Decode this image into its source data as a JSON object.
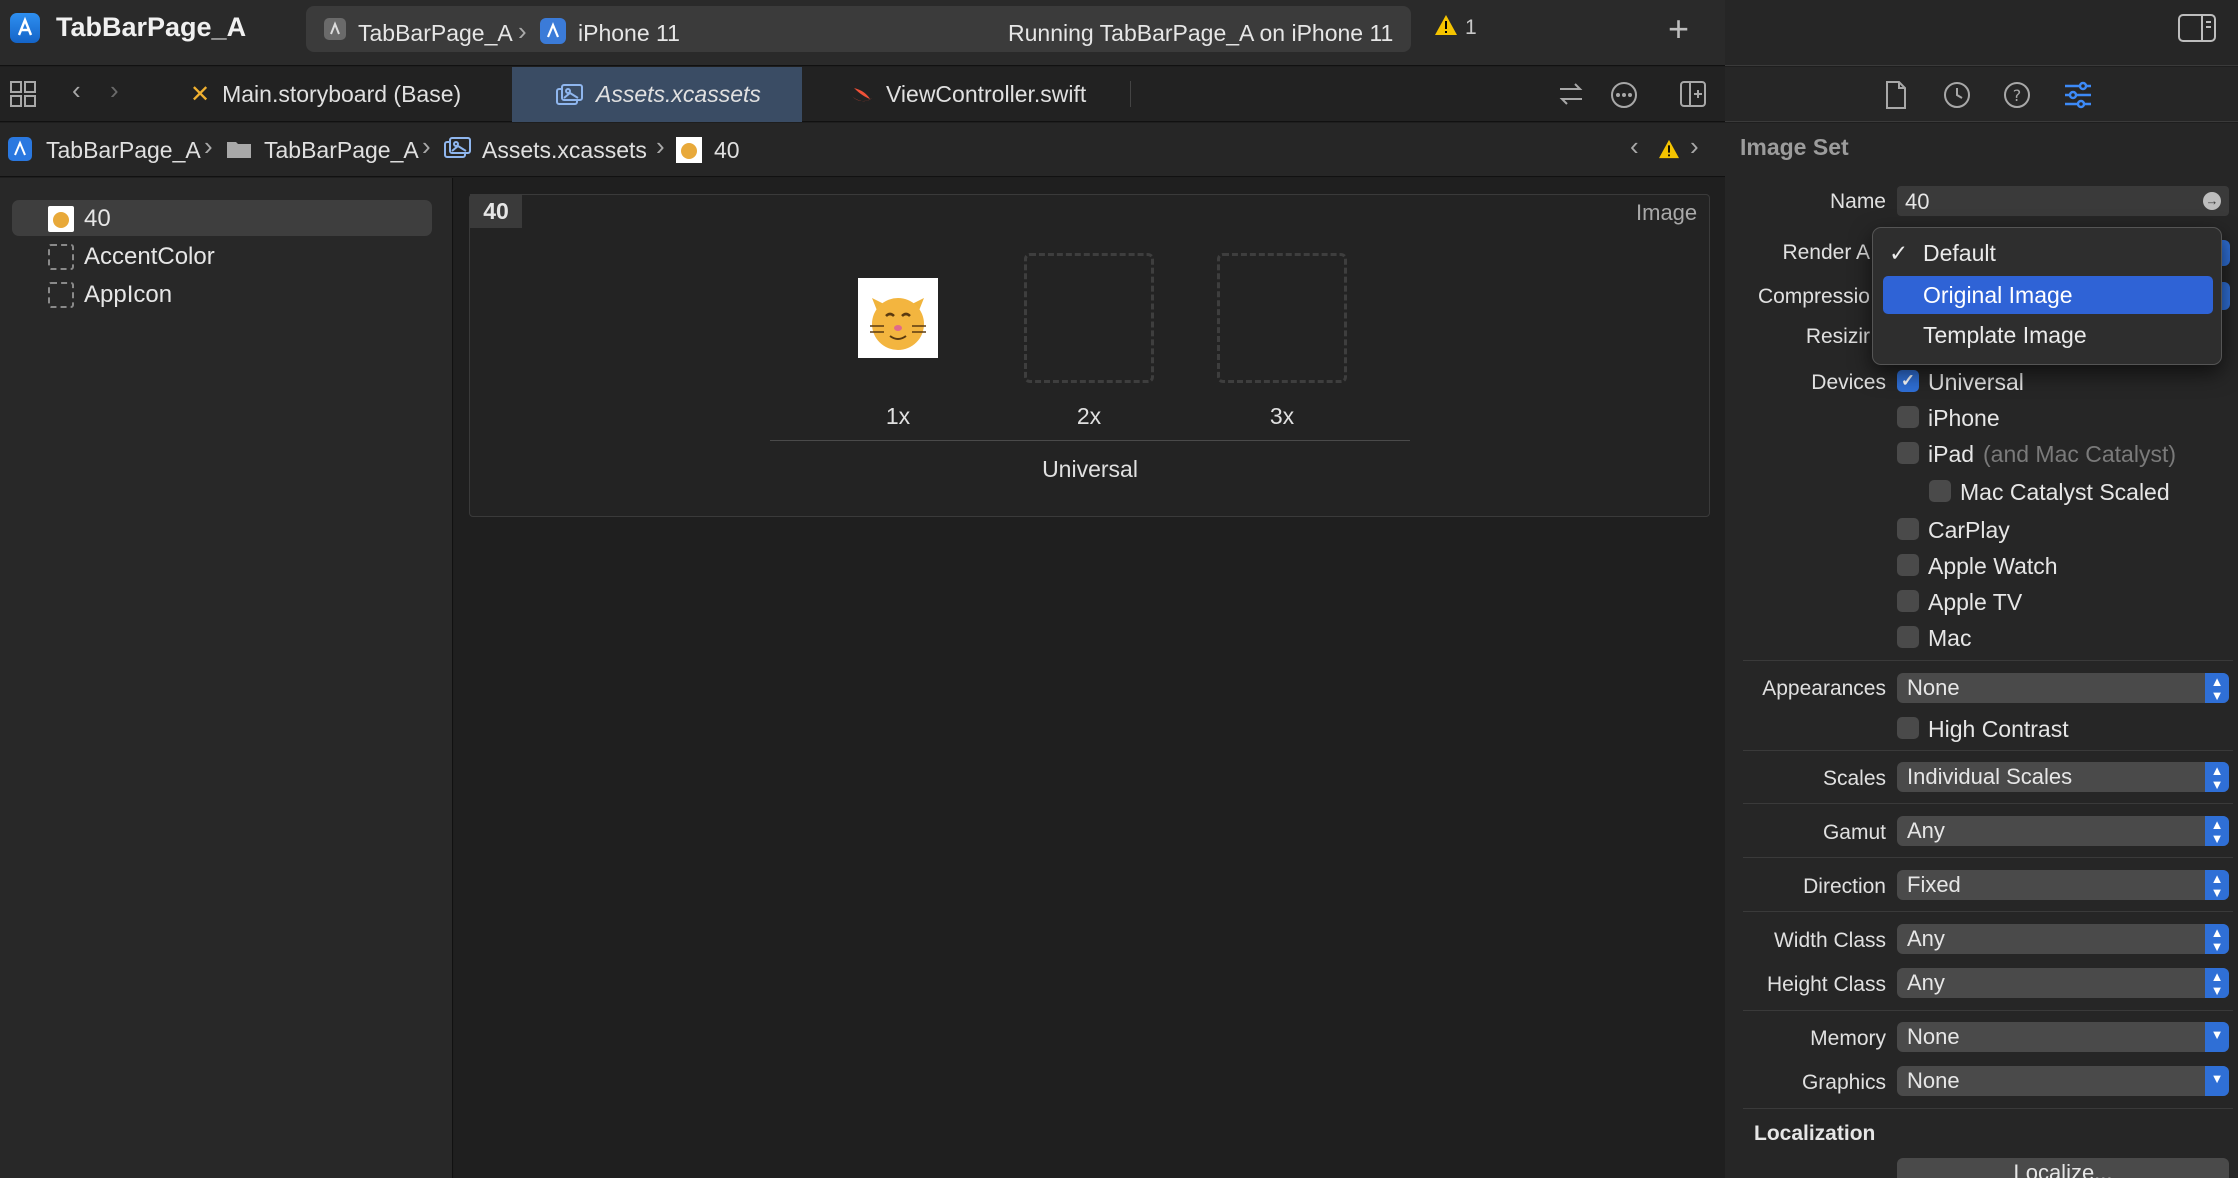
{
  "toolbar": {
    "app_title": "TabBarPage_A",
    "scheme": "TabBarPage_A",
    "destination": "iPhone 11",
    "status": "Running TabBarPage_A on iPhone 11",
    "warning_count": "1",
    "add_icon": "plus-icon"
  },
  "tabs": [
    {
      "label": "Main.storyboard (Base)",
      "icon": "storyboard-icon"
    },
    {
      "label": "Assets.xcassets",
      "icon": "asset-catalog-icon",
      "active": true
    },
    {
      "label": "ViewController.swift",
      "icon": "swift-icon"
    }
  ],
  "jumpbar": {
    "project": "TabBarPage_A",
    "folder": "TabBarPage_A",
    "catalog": "Assets.xcassets",
    "asset": "40"
  },
  "navigator": {
    "items": [
      {
        "label": "40",
        "selected": true
      },
      {
        "label": "AccentColor"
      },
      {
        "label": "AppIcon"
      }
    ]
  },
  "editor": {
    "asset_name": "40",
    "asset_kind": "Image",
    "slots": [
      {
        "scale": "1x",
        "filled": true
      },
      {
        "scale": "2x"
      },
      {
        "scale": "3x"
      }
    ],
    "device_group": "Universal"
  },
  "inspector": {
    "section_title": "Image Set",
    "name_label": "Name",
    "name_value": "40",
    "render_label": "Render A",
    "compression_label": "Compressio",
    "resizing_label": "Resizir",
    "devices_label": "Devices",
    "devices": [
      {
        "label": "Universal",
        "checked": true
      },
      {
        "label": "iPhone"
      },
      {
        "label": "iPad",
        "note": "(and Mac Catalyst)"
      },
      {
        "label": "Mac Catalyst Scaled"
      },
      {
        "label": "CarPlay"
      },
      {
        "label": "Apple Watch"
      },
      {
        "label": "Apple TV"
      },
      {
        "label": "Mac"
      }
    ],
    "appearances_label": "Appearances",
    "appearances_value": "None",
    "high_contrast": "High Contrast",
    "scales_label": "Scales",
    "scales_value": "Individual Scales",
    "gamut_label": "Gamut",
    "gamut_value": "Any",
    "direction_label": "Direction",
    "direction_value": "Fixed",
    "width_class_label": "Width Class",
    "width_class_value": "Any",
    "height_class_label": "Height Class",
    "height_class_value": "Any",
    "memory_label": "Memory",
    "memory_value": "None",
    "graphics_label": "Graphics",
    "graphics_value": "None",
    "localization_title": "Localization",
    "localize_button": "Localize..."
  },
  "render_menu": {
    "items": [
      {
        "label": "Default",
        "checked": true
      },
      {
        "label": "Original Image",
        "highlighted": true
      },
      {
        "label": "Template Image"
      }
    ]
  },
  "colors": {
    "accent": "#2f6fd6",
    "warning": "#f5c400",
    "selection": "#2f63d6"
  }
}
